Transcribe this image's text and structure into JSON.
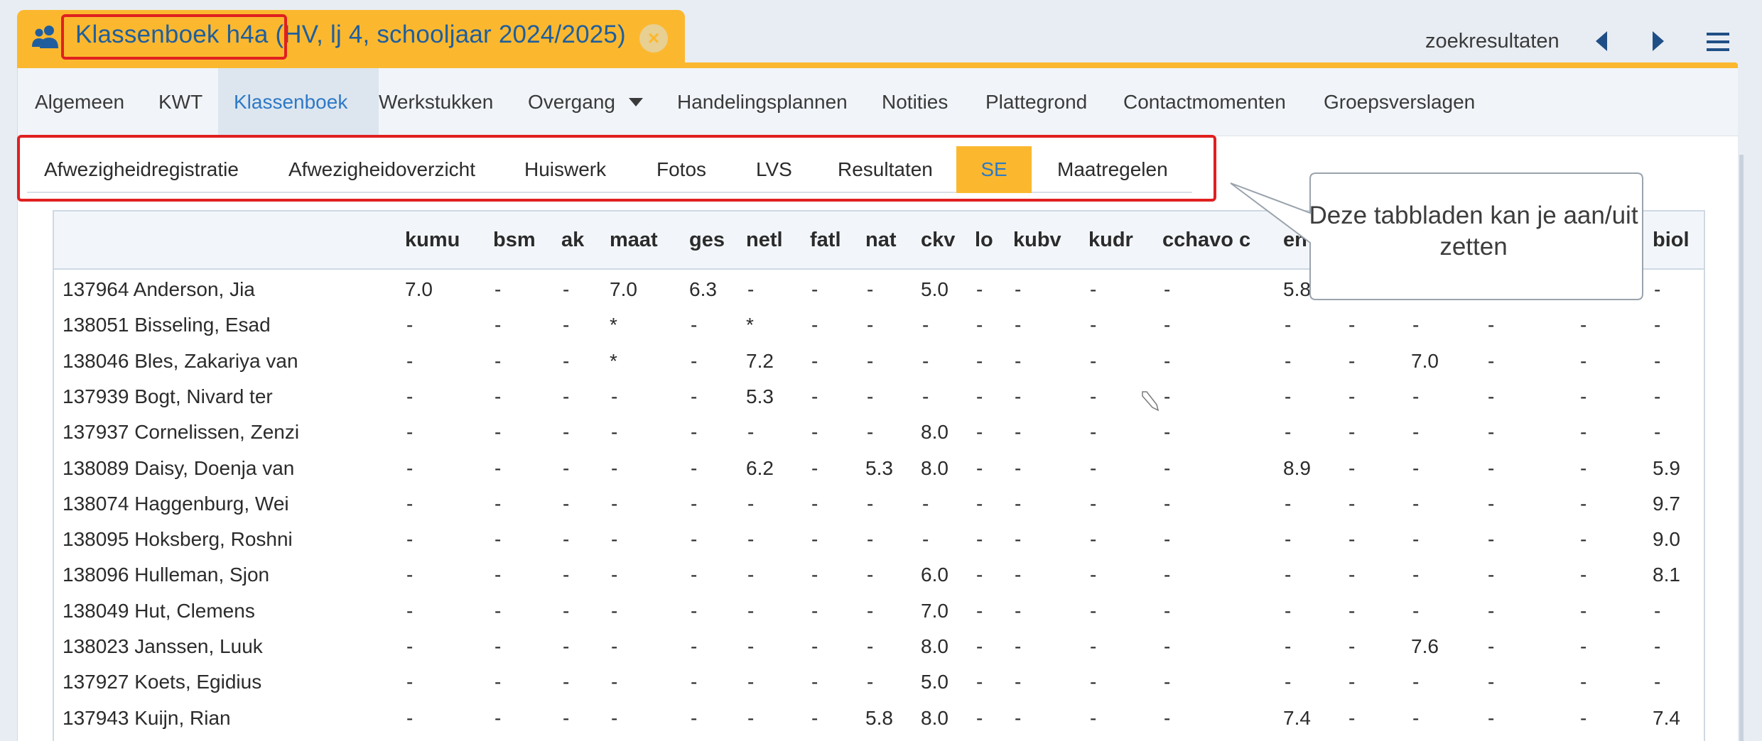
{
  "title": {
    "text": "Klassenboek h4a (HV, lj 4, schooljaar 2024/2025)",
    "icon": "users-icon",
    "close_icon": "close-circle-icon"
  },
  "top_right": {
    "search_results": "zoekresultaten",
    "prev_icon": "triangle-left-icon",
    "next_icon": "triangle-right-icon",
    "menu_icon": "hamburger-menu-icon"
  },
  "main_tabs": [
    {
      "label": "Algemeen"
    },
    {
      "label": "KWT"
    },
    {
      "label": "Klassenboek",
      "active": true
    },
    {
      "label": "Werkstukken"
    },
    {
      "label": "Overgang",
      "dropdown": true
    },
    {
      "label": "Handelingsplannen"
    },
    {
      "label": "Notities"
    },
    {
      "label": "Plattegrond"
    },
    {
      "label": "Contactmomenten"
    },
    {
      "label": "Groepsverslagen"
    }
  ],
  "sub_tabs": [
    {
      "label": "Afwezigheidregistratie"
    },
    {
      "label": "Afwezigheidoverzicht"
    },
    {
      "label": "Huiswerk"
    },
    {
      "label": "Fotos"
    },
    {
      "label": "LVS"
    },
    {
      "label": "Resultaten"
    },
    {
      "label": "SE",
      "active": true
    },
    {
      "label": "Maatregelen"
    }
  ],
  "callout": {
    "text": "Deze tabbladen kan je aan/uit zetten"
  },
  "table": {
    "columns": [
      "kumu",
      "bsm",
      "ak",
      "maat",
      "ges",
      "netl",
      "fatl",
      "nat",
      "ckv",
      "lo",
      "kubv",
      "kudr",
      "cchavo c",
      "en",
      "",
      "",
      "",
      "",
      "biol"
    ],
    "rows": [
      {
        "name": "137964 Anderson, Jia",
        "cells": [
          "7.0",
          "-",
          "-",
          "7.0",
          "6.3",
          "-",
          "-",
          "-",
          "5.0",
          "-",
          "-",
          "-",
          "-",
          "5.8",
          "",
          "",
          "",
          "",
          "-"
        ]
      },
      {
        "name": "138051 Bisseling, Esad",
        "cells": [
          "-",
          "-",
          "-",
          "*",
          "-",
          "*",
          "-",
          "-",
          "-",
          "-",
          "-",
          "-",
          "-",
          "-",
          "-",
          "-",
          "-",
          "-",
          "-"
        ]
      },
      {
        "name": "138046 Bles, Zakariya van",
        "cells": [
          "-",
          "-",
          "-",
          "*",
          "-",
          "7.2",
          "-",
          "-",
          "-",
          "-",
          "-",
          "-",
          "-",
          "-",
          "-",
          "7.0",
          "-",
          "-",
          "-"
        ]
      },
      {
        "name": "137939 Bogt, Nivard ter",
        "cells": [
          "-",
          "-",
          "-",
          "-",
          "-",
          "5.3",
          "-",
          "-",
          "-",
          "-",
          "-",
          "-",
          "-",
          "-",
          "-",
          "-",
          "-",
          "-",
          "-"
        ]
      },
      {
        "name": "137937 Cornelissen, Zenzi",
        "cells": [
          "-",
          "-",
          "-",
          "-",
          "-",
          "-",
          "-",
          "-",
          "8.0",
          "-",
          "-",
          "-",
          "-",
          "-",
          "-",
          "-",
          "-",
          "-",
          "-"
        ]
      },
      {
        "name": "138089 Daisy, Doenja van",
        "cells": [
          "-",
          "-",
          "-",
          "-",
          "-",
          "6.2",
          "-",
          "5.3",
          "8.0",
          "-",
          "-",
          "-",
          "-",
          "8.9",
          "-",
          "-",
          "-",
          "-",
          "5.9"
        ]
      },
      {
        "name": "138074 Haggenburg, Wei",
        "cells": [
          "-",
          "-",
          "-",
          "-",
          "-",
          "-",
          "-",
          "-",
          "-",
          "-",
          "-",
          "-",
          "-",
          "-",
          "-",
          "-",
          "-",
          "-",
          "9.7"
        ]
      },
      {
        "name": "138095 Hoksberg, Roshni",
        "cells": [
          "-",
          "-",
          "-",
          "-",
          "-",
          "-",
          "-",
          "-",
          "-",
          "-",
          "-",
          "-",
          "-",
          "-",
          "-",
          "-",
          "-",
          "-",
          "9.0"
        ]
      },
      {
        "name": "138096 Hulleman, Sjon",
        "cells": [
          "-",
          "-",
          "-",
          "-",
          "-",
          "-",
          "-",
          "-",
          "6.0",
          "-",
          "-",
          "-",
          "-",
          "-",
          "-",
          "-",
          "-",
          "-",
          "8.1"
        ]
      },
      {
        "name": "138049 Hut, Clemens",
        "cells": [
          "-",
          "-",
          "-",
          "-",
          "-",
          "-",
          "-",
          "-",
          "7.0",
          "-",
          "-",
          "-",
          "-",
          "-",
          "-",
          "-",
          "-",
          "-",
          "-"
        ]
      },
      {
        "name": "138023 Janssen, Luuk",
        "cells": [
          "-",
          "-",
          "-",
          "-",
          "-",
          "-",
          "-",
          "-",
          "8.0",
          "-",
          "-",
          "-",
          "-",
          "-",
          "-",
          "7.6",
          "-",
          "-",
          "-"
        ]
      },
      {
        "name": "137927 Koets, Egidius",
        "cells": [
          "-",
          "-",
          "-",
          "-",
          "-",
          "-",
          "-",
          "-",
          "5.0",
          "-",
          "-",
          "-",
          "-",
          "-",
          "-",
          "-",
          "-",
          "-",
          "-"
        ]
      },
      {
        "name": "137943 Kuijn, Rian",
        "cells": [
          "-",
          "-",
          "-",
          "-",
          "-",
          "-",
          "-",
          "5.8",
          "8.0",
          "-",
          "-",
          "-",
          "-",
          "7.4",
          "-",
          "-",
          "-",
          "-",
          "7.4"
        ]
      }
    ]
  },
  "colors": {
    "accent_orange": "#fbb82f",
    "link_blue": "#2e79c6",
    "title_blue": "#1f5e9e",
    "highlight_red": "#e02020"
  }
}
